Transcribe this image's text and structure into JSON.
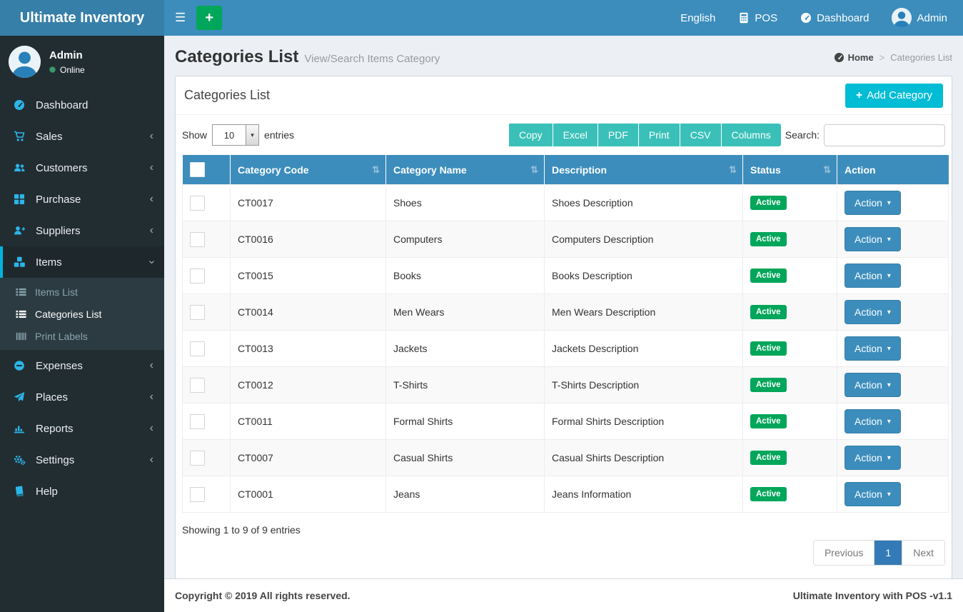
{
  "navbar": {
    "brand": "Ultimate Inventory",
    "items": [
      {
        "label": "English"
      },
      {
        "label": "POS"
      },
      {
        "label": "Dashboard"
      },
      {
        "label": "Admin"
      }
    ]
  },
  "sidebar": {
    "user": {
      "name": "Admin",
      "status": "Online"
    },
    "items": [
      {
        "label": "Dashboard"
      },
      {
        "label": "Sales",
        "chevron": "‹"
      },
      {
        "label": "Customers",
        "chevron": "‹"
      },
      {
        "label": "Purchase",
        "chevron": "‹"
      },
      {
        "label": "Suppliers",
        "chevron": "‹"
      },
      {
        "label": "Items",
        "chevron": "‹",
        "active": true
      },
      {
        "label": "Expenses",
        "chevron": "‹"
      },
      {
        "label": "Places",
        "chevron": "‹"
      },
      {
        "label": "Reports",
        "chevron": "‹"
      },
      {
        "label": "Settings",
        "chevron": "‹"
      },
      {
        "label": "Help"
      }
    ],
    "items_submenu": [
      {
        "label": "Items List"
      },
      {
        "label": "Categories List",
        "active": true
      },
      {
        "label": "Print Labels"
      }
    ]
  },
  "page_header": {
    "title": "Categories List",
    "subtitle": "View/Search Items Category",
    "breadcrumb": {
      "home": "Home",
      "separator": ">",
      "current": "Categories List"
    }
  },
  "panel": {
    "title": "Categories List",
    "add_button": "Add Category",
    "length_menu": {
      "show": "Show",
      "value": "10",
      "entries": "entries"
    },
    "export_buttons": [
      "Copy",
      "Excel",
      "PDF",
      "Print",
      "CSV",
      "Columns"
    ],
    "search": {
      "label": "Search:",
      "value": ""
    },
    "table": {
      "headers": [
        "Category Code",
        "Category Name",
        "Description",
        "Status",
        "Action"
      ],
      "rows": [
        {
          "code": "CT0017",
          "name": "Shoes",
          "description": "Shoes Description",
          "status": "Active",
          "action": "Action"
        },
        {
          "code": "CT0016",
          "name": "Computers",
          "description": "Computers Description",
          "status": "Active",
          "action": "Action"
        },
        {
          "code": "CT0015",
          "name": "Books",
          "description": "Books Description",
          "status": "Active",
          "action": "Action"
        },
        {
          "code": "CT0014",
          "name": "Men Wears",
          "description": "Men Wears Description",
          "status": "Active",
          "action": "Action"
        },
        {
          "code": "CT0013",
          "name": "Jackets",
          "description": "Jackets Description",
          "status": "Active",
          "action": "Action"
        },
        {
          "code": "CT0012",
          "name": "T-Shirts",
          "description": "T-Shirts Description",
          "status": "Active",
          "action": "Action"
        },
        {
          "code": "CT0011",
          "name": "Formal Shirts",
          "description": "Formal Shirts Description",
          "status": "Active",
          "action": "Action"
        },
        {
          "code": "CT0007",
          "name": "Casual Shirts",
          "description": "Casual Shirts Description",
          "status": "Active",
          "action": "Action"
        },
        {
          "code": "CT0001",
          "name": "Jeans",
          "description": "Jeans Information",
          "status": "Active",
          "action": "Action"
        }
      ]
    },
    "info": "Showing 1 to 9 of 9 entries",
    "pagination": {
      "previous": "Previous",
      "page": "1",
      "next": "Next"
    }
  },
  "footer": {
    "left": "Copyright © 2019 All rights reserved.",
    "right": "Ultimate Inventory with POS -v1.1"
  },
  "icons": {
    "hamburger": "☰",
    "plus": "+",
    "caret_down": "▾",
    "sort": "⇅"
  },
  "colors": {
    "navbar": "#3c8dbc",
    "logo_bg": "#367fa9",
    "sidebar_bg": "#222d32",
    "sidebar_icon": "#2cb5e8",
    "accent_cyan": "#00bcd4",
    "teal_button": "#3ac0b8",
    "success_green": "#00a65a",
    "table_header": "#3c8dbc",
    "pagination_active": "#337ab7"
  }
}
